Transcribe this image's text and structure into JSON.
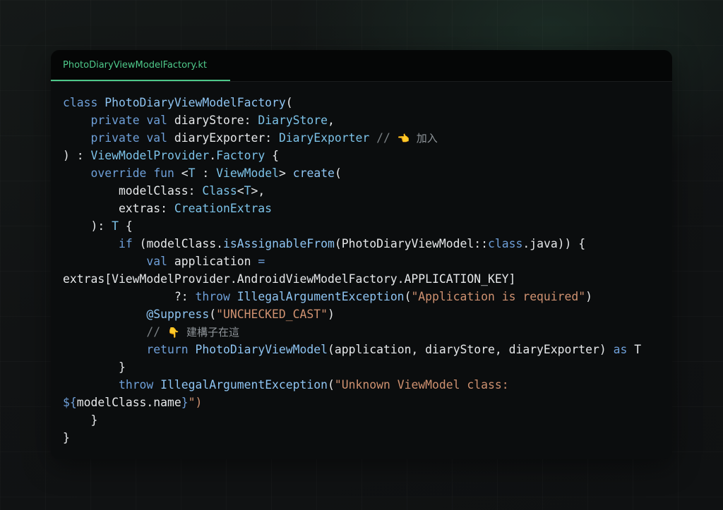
{
  "editor": {
    "tab_label": "PhotoDiaryViewModelFactory.kt"
  },
  "code": {
    "lines": [
      [
        {
          "t": "class",
          "c": "kw"
        },
        {
          "t": " ",
          "c": "pl"
        },
        {
          "t": "PhotoDiaryViewModelFactory",
          "c": "fn"
        },
        {
          "t": "(",
          "c": "pl"
        }
      ],
      [
        {
          "t": "    ",
          "c": "pl"
        },
        {
          "t": "private",
          "c": "kw"
        },
        {
          "t": " ",
          "c": "pl"
        },
        {
          "t": "val",
          "c": "kw"
        },
        {
          "t": " diaryStore: ",
          "c": "pl"
        },
        {
          "t": "DiaryStore",
          "c": "ty"
        },
        {
          "t": ",",
          "c": "pl"
        }
      ],
      [
        {
          "t": "    ",
          "c": "pl"
        },
        {
          "t": "private",
          "c": "kw"
        },
        {
          "t": " ",
          "c": "pl"
        },
        {
          "t": "val",
          "c": "kw"
        },
        {
          "t": " diaryExporter: ",
          "c": "pl"
        },
        {
          "t": "DiaryExporter",
          "c": "ty"
        },
        {
          "t": " // ",
          "c": "cm"
        },
        {
          "t": "👈",
          "c": "emoji"
        },
        {
          "t": "  加入",
          "c": "cmcn"
        }
      ],
      [
        {
          "t": ") : ",
          "c": "pl"
        },
        {
          "t": "ViewModelProvider",
          "c": "ty"
        },
        {
          "t": ".",
          "c": "pl"
        },
        {
          "t": "Factory",
          "c": "ty"
        },
        {
          "t": " {",
          "c": "pl"
        }
      ],
      [
        {
          "t": "    ",
          "c": "pl"
        },
        {
          "t": "override",
          "c": "kw"
        },
        {
          "t": " ",
          "c": "pl"
        },
        {
          "t": "fun",
          "c": "kw"
        },
        {
          "t": " <",
          "c": "pl"
        },
        {
          "t": "T",
          "c": "ty"
        },
        {
          "t": " : ",
          "c": "pl"
        },
        {
          "t": "ViewModel",
          "c": "ty"
        },
        {
          "t": "> ",
          "c": "pl"
        },
        {
          "t": "create",
          "c": "fn"
        },
        {
          "t": "(",
          "c": "pl"
        }
      ],
      [
        {
          "t": "        modelClass: ",
          "c": "pl"
        },
        {
          "t": "Class",
          "c": "ty"
        },
        {
          "t": "<",
          "c": "pl"
        },
        {
          "t": "T",
          "c": "ty"
        },
        {
          "t": ">,",
          "c": "pl"
        }
      ],
      [
        {
          "t": "        extras: ",
          "c": "pl"
        },
        {
          "t": "CreationExtras",
          "c": "ty"
        }
      ],
      [
        {
          "t": "    ): ",
          "c": "pl"
        },
        {
          "t": "T",
          "c": "ty"
        },
        {
          "t": " {",
          "c": "pl"
        }
      ],
      [
        {
          "t": "        ",
          "c": "pl"
        },
        {
          "t": "if",
          "c": "kw"
        },
        {
          "t": " (modelClass.",
          "c": "pl"
        },
        {
          "t": "isAssignableFrom",
          "c": "fn"
        },
        {
          "t": "(PhotoDiaryViewModel::",
          "c": "pl"
        },
        {
          "t": "class",
          "c": "kw"
        },
        {
          "t": ".java)) {",
          "c": "pl"
        }
      ],
      [
        {
          "t": "            ",
          "c": "pl"
        },
        {
          "t": "val",
          "c": "kw"
        },
        {
          "t": " application ",
          "c": "pl"
        },
        {
          "t": "=",
          "c": "kw"
        }
      ],
      [
        {
          "t": "extras[ViewModelProvider.AndroidViewModelFactory.APPLICATION_KEY]",
          "c": "pl"
        }
      ],
      [
        {
          "t": "                ?: ",
          "c": "pl"
        },
        {
          "t": "throw",
          "c": "kw"
        },
        {
          "t": " ",
          "c": "pl"
        },
        {
          "t": "IllegalArgumentException",
          "c": "fn"
        },
        {
          "t": "(",
          "c": "pl"
        },
        {
          "t": "\"Application is required\"",
          "c": "str"
        },
        {
          "t": ")",
          "c": "pl"
        }
      ],
      [
        {
          "t": "            ",
          "c": "pl"
        },
        {
          "t": "@Suppress",
          "c": "fn"
        },
        {
          "t": "(",
          "c": "pl"
        },
        {
          "t": "\"UNCHECKED_CAST\"",
          "c": "str"
        },
        {
          "t": ")",
          "c": "pl"
        }
      ],
      [
        {
          "t": "            // ",
          "c": "cm"
        },
        {
          "t": "👇",
          "c": "emoji"
        },
        {
          "t": "  建構子在這",
          "c": "cmcn"
        }
      ],
      [
        {
          "t": "            ",
          "c": "pl"
        },
        {
          "t": "return",
          "c": "kw"
        },
        {
          "t": " ",
          "c": "pl"
        },
        {
          "t": "PhotoDiaryViewModel",
          "c": "fn"
        },
        {
          "t": "(application, diaryStore, diaryExporter) ",
          "c": "pl"
        },
        {
          "t": "as",
          "c": "kw"
        },
        {
          "t": " T",
          "c": "pl"
        }
      ],
      [
        {
          "t": "        }",
          "c": "pl"
        }
      ],
      [
        {
          "t": "        ",
          "c": "pl"
        },
        {
          "t": "throw",
          "c": "kw"
        },
        {
          "t": " ",
          "c": "pl"
        },
        {
          "t": "IllegalArgumentException",
          "c": "fn"
        },
        {
          "t": "(",
          "c": "pl"
        },
        {
          "t": "\"Unknown ViewModel class:",
          "c": "str"
        }
      ],
      [
        {
          "t": "${",
          "c": "kw"
        },
        {
          "t": "modelClass.name",
          "c": "pl"
        },
        {
          "t": "}",
          "c": "kw"
        },
        {
          "t": "\")",
          "c": "str"
        }
      ],
      [
        {
          "t": "    }",
          "c": "pl"
        }
      ],
      [
        {
          "t": "}",
          "c": "pl"
        }
      ]
    ]
  },
  "colors": {
    "tab_accent": "#4ec98a",
    "keyword": "#6e9fd8",
    "type": "#7cc2e8",
    "function": "#8ec4f2",
    "string": "#cf9170",
    "comment": "#7a8084",
    "plain": "#e6e8ea",
    "card_background": "#0b0d0e"
  }
}
